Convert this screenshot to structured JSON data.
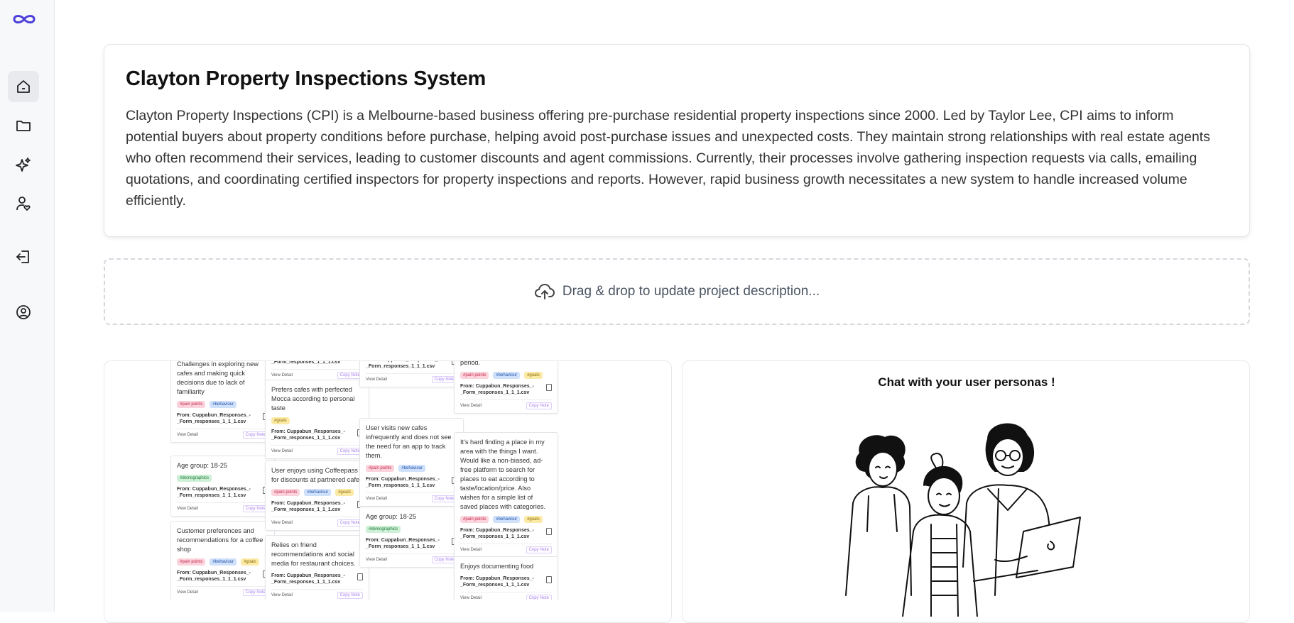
{
  "sidebar": {
    "logo_icon": "infinity-icon",
    "items": [
      {
        "name": "home",
        "icon": "home-icon",
        "active": true
      },
      {
        "name": "projects",
        "icon": "folder-icon",
        "active": false
      },
      {
        "name": "ai",
        "icon": "sparkles-icon",
        "active": false
      },
      {
        "name": "personas",
        "icon": "user-heart-icon",
        "active": false
      },
      {
        "name": "logout",
        "icon": "logout-icon",
        "active": false
      },
      {
        "name": "account",
        "icon": "user-circle-icon",
        "active": false
      }
    ]
  },
  "project": {
    "title": "Clayton Property Inspections System",
    "description": "Clayton Property Inspections (CPI) is a Melbourne-based business offering pre-purchase residential property inspections since 2000. Led by Taylor Lee, CPI aims to inform potential buyers about property conditions before purchase, helping avoid post-purchase issues and unexpected costs. They maintain strong relationships with real estate agents who often recommend their services, leading to customer discounts and agent commissions. Currently, their processes involve gathering inspection requests via calls, emailing quotations, and coordinating certified inspectors for property inspections and reports. However, rapid business growth necessitates a new system to handle increased volume efficiently."
  },
  "dropzone": {
    "icon": "cloud-upload-icon",
    "label": "Drag & drop to update project description..."
  },
  "notes_board": {
    "view_detail": "View Detail",
    "copy_note": "Copy Note",
    "source": "From: Cuppabun_Responses_-_Form_responses_1_1_1.csv",
    "tag_labels": {
      "pain": "#pain points",
      "behav": "#behaviour",
      "goals": "#goals",
      "demo": "#demographics"
    },
    "columns": [
      [
        {
          "text": "Challenges in exploring new cafes and making quick decisions due to lack of familiarity",
          "tags": [
            "pain",
            "behav"
          ]
        },
        {
          "text": "Age group: 18-25",
          "tags": [
            "demo"
          ]
        },
        {
          "text": "Customer preferences and recommendations for a coffee shop",
          "tags": [
            "pain",
            "behav",
            "goals"
          ]
        }
      ],
      [
        {
          "text": "",
          "tags": []
        },
        {
          "text": "Prefers cafes with perfected Mocca according to personal taste",
          "tags": [
            "goals"
          ]
        },
        {
          "text": "User enjoys using Coffeepass for discounts at partnered cafes",
          "tags": [
            "pain",
            "behav",
            "goals"
          ]
        },
        {
          "text": "Relies on friend recommendations and social media for restaurant choices.",
          "tags": []
        }
      ],
      [
        {
          "text": "",
          "tags": [
            "demo"
          ]
        },
        {
          "text": "User visits new cafes infrequently and does not see the need for an app to track them.",
          "tags": [
            "pain",
            "behav"
          ]
        },
        {
          "text": "Age group: 18-25",
          "tags": [
            "demo"
          ]
        }
      ],
      [
        {
          "text": "to know when there's a quiet period.",
          "tags": [
            "pain",
            "behav",
            "goals"
          ]
        },
        {
          "text": "It's hard finding a place in my area with the things I want. Would like a non-biased, ad-free platform to search for places to eat according to taste/location/price. Also wishes for a simple list of saved places with categories.",
          "tags": [
            "pain",
            "behav",
            "goals"
          ]
        },
        {
          "text": "Enjoys documenting food",
          "tags": []
        }
      ]
    ]
  },
  "chat": {
    "title": "Chat with your user personas !"
  }
}
